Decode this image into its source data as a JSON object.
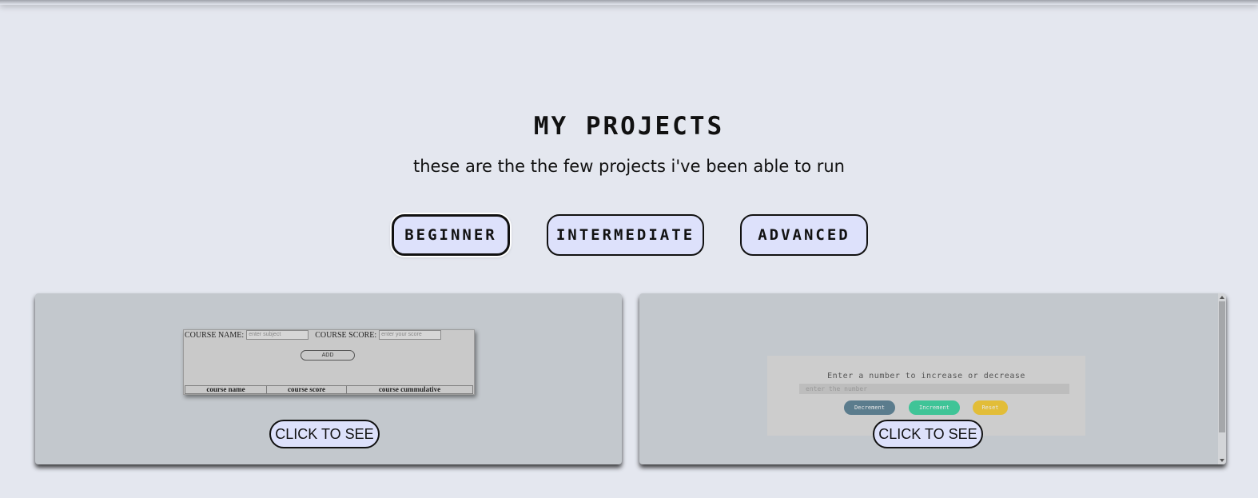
{
  "header": {
    "title": "MY PROJECTS",
    "subtitle": "these are the the few projects i've been able to run"
  },
  "tabs": [
    {
      "label": "BEGINNER",
      "active": true
    },
    {
      "label": "INTERMEDIATE",
      "active": false
    },
    {
      "label": "ADVANCED",
      "active": false
    }
  ],
  "projects": [
    {
      "cta_label": "CLICK TO SEE",
      "preview": {
        "course_name_label": "COURSE NAME:",
        "course_name_placeholder": "enter subject",
        "course_score_label": "COURSE SCORE:",
        "course_score_placeholder": "enter your score",
        "add_label": "ADD",
        "columns": [
          "course name",
          "course score",
          "course cummulative"
        ]
      }
    },
    {
      "cta_label": "CLICK TO SEE",
      "preview": {
        "title": "Enter a number to increase or decrease",
        "input_placeholder": "enter the number",
        "decrement_label": "Decrement",
        "increment_label": "Increment",
        "reset_label": "Reset"
      }
    }
  ],
  "colors": {
    "background": "#e4e7ef",
    "button_fill": "#dde1fb",
    "card_fill": "#c3c8cd",
    "decrement": "#5b7c8d",
    "increment": "#3fc497",
    "reset": "#e2bd38"
  }
}
